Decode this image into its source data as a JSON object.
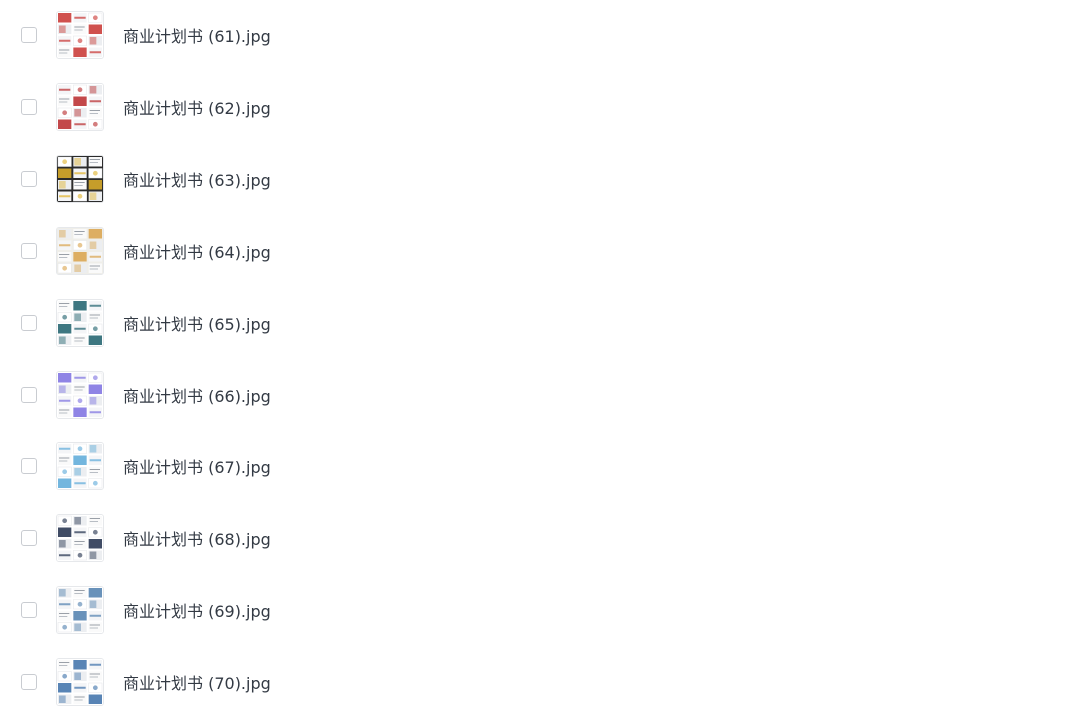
{
  "files": [
    {
      "name": "商业计划书 (61).jpg",
      "thumb_style": "red-white-infographic",
      "accent": "#c8322f",
      "bg": "#ffffff"
    },
    {
      "name": "商业计划书 (62).jpg",
      "thumb_style": "red-white-slides",
      "accent": "#b8282a",
      "bg": "#ffffff"
    },
    {
      "name": "商业计划书 (63).jpg",
      "thumb_style": "dark-gold-slides",
      "accent": "#e0b22a",
      "bg": "#2b2b2b"
    },
    {
      "name": "商业计划书 (64).jpg",
      "thumb_style": "beige-map-slides",
      "accent": "#d9a24a",
      "bg": "#efeee9"
    },
    {
      "name": "商业计划书 (65).jpg",
      "thumb_style": "teal-photo-slides",
      "accent": "#1c5f6b",
      "bg": "#ffffff"
    },
    {
      "name": "商业计划书 (66).jpg",
      "thumb_style": "purple-white-slides",
      "accent": "#7b6fe0",
      "bg": "#ffffff"
    },
    {
      "name": "商业计划书 (67).jpg",
      "thumb_style": "light-blue-slides",
      "accent": "#5aa9d8",
      "bg": "#ffffff"
    },
    {
      "name": "商业计划书 (68).jpg",
      "thumb_style": "navy-photo-slides",
      "accent": "#1e2d4a",
      "bg": "#ffffff"
    },
    {
      "name": "商业计划书 (69).jpg",
      "thumb_style": "steel-blue-slides",
      "accent": "#4f7fae",
      "bg": "#ffffff"
    },
    {
      "name": "商业计划书 (70).jpg",
      "thumb_style": "blue-building-slides",
      "accent": "#3b6fa8",
      "bg": "#ffffff"
    }
  ],
  "colors": {
    "text": "#333a44",
    "checkbox_border": "#c9ccd1",
    "thumb_border": "#e6e8eb"
  }
}
